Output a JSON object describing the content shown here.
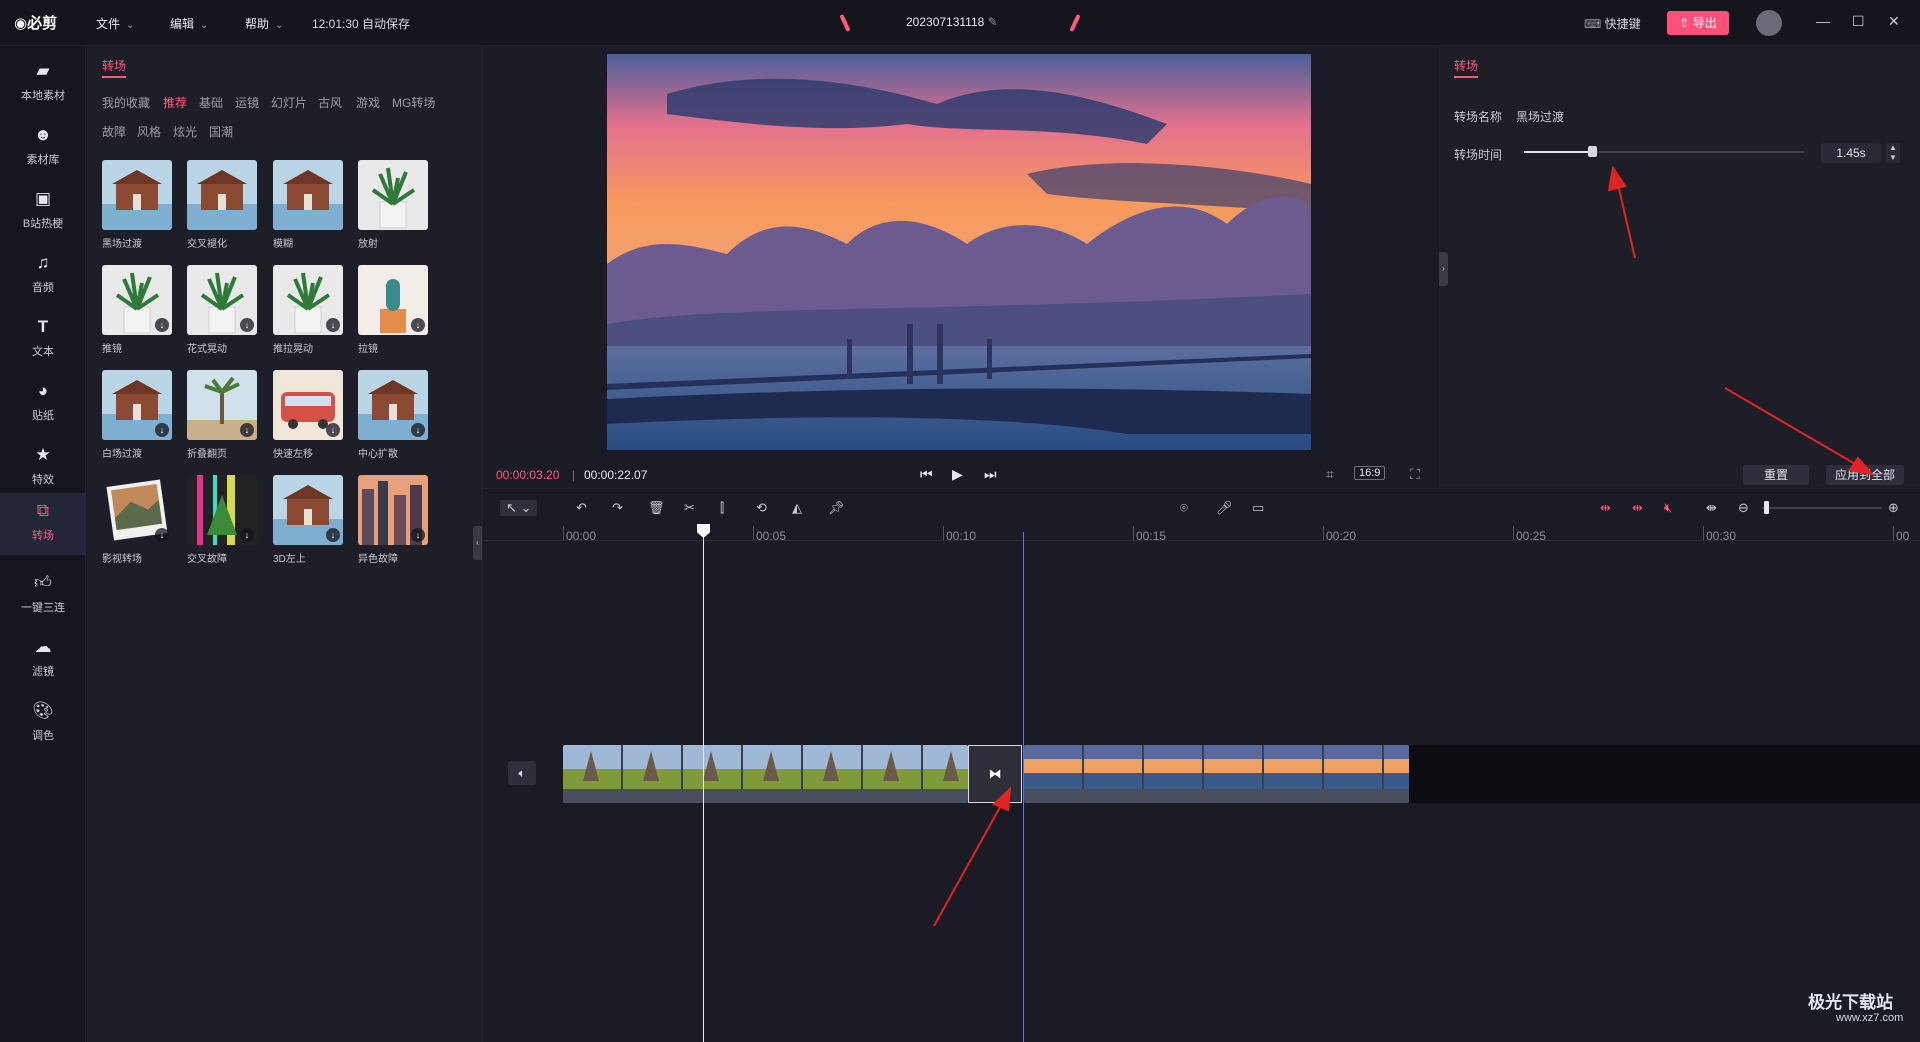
{
  "app": {
    "logo": "必剪",
    "menus": [
      "文件",
      "编辑",
      "帮助"
    ],
    "autosave": "12:01:30 自动保存",
    "project_title": "202307131118",
    "shortcut_label": "快捷键",
    "export_label": "导出"
  },
  "nav": [
    {
      "label": "本地素材",
      "icon": "folder-icon"
    },
    {
      "label": "素材库",
      "icon": "face-icon"
    },
    {
      "label": "B站热梗",
      "icon": "tv-icon"
    },
    {
      "label": "音频",
      "icon": "music-icon"
    },
    {
      "label": "文本",
      "icon": "text-icon"
    },
    {
      "label": "贴纸",
      "icon": "sticker-icon"
    },
    {
      "label": "特效",
      "icon": "star-icon"
    },
    {
      "label": "转场",
      "icon": "transition-icon",
      "active": true
    },
    {
      "label": "一键三连",
      "icon": "thumb-icon"
    },
    {
      "label": "滤镜",
      "icon": "filter-icon"
    },
    {
      "label": "调色",
      "icon": "palette-icon"
    }
  ],
  "library": {
    "tab": "转场",
    "categories_row1": [
      "我的收藏",
      "推荐",
      "基础",
      "运镜",
      "幻灯片",
      "古风",
      "游戏",
      "MG转场"
    ],
    "categories_row2": [
      "故障",
      "风格",
      "炫光",
      "国潮"
    ],
    "active_category": "推荐",
    "items": [
      {
        "label": "黑场过渡",
        "scene": "house",
        "download": false
      },
      {
        "label": "交叉褪化",
        "scene": "house",
        "download": false
      },
      {
        "label": "模糊",
        "scene": "house",
        "download": false
      },
      {
        "label": "放射",
        "scene": "plant",
        "download": false
      },
      {
        "label": "推镜",
        "scene": "plant",
        "download": true
      },
      {
        "label": "花式晃动",
        "scene": "plant",
        "download": true
      },
      {
        "label": "推拉晃动",
        "scene": "plant",
        "download": true
      },
      {
        "label": "拉镜",
        "scene": "cactus",
        "download": true
      },
      {
        "label": "白场过渡",
        "scene": "house",
        "download": true
      },
      {
        "label": "折叠翻页",
        "scene": "palm",
        "download": true
      },
      {
        "label": "快速左移",
        "scene": "bus",
        "download": true
      },
      {
        "label": "中心扩散",
        "scene": "house",
        "download": true
      },
      {
        "label": "影视转场",
        "scene": "photo",
        "download": true
      },
      {
        "label": "交叉故障",
        "scene": "glitch",
        "download": true
      },
      {
        "label": "3D左上",
        "scene": "house",
        "download": true
      },
      {
        "label": "异色故障",
        "scene": "city",
        "download": true
      }
    ]
  },
  "preview": {
    "current_time": "00:00:03.20",
    "total_time": "00:00:22.07",
    "ratio": "16:9"
  },
  "properties": {
    "tab": "转场",
    "name_label": "转场名称",
    "name_value": "黑场过渡",
    "duration_label": "转场时间",
    "duration_value": "1.45s",
    "reset_label": "重置",
    "apply_all_label": "应用到全部"
  },
  "timeline": {
    "ruler": [
      "00:00",
      "00:05",
      "00:10",
      "00:15",
      "00:20",
      "00:25",
      "00:30",
      "00"
    ]
  },
  "watermark": {
    "title": "极光下载站",
    "url": "www.xz7.com"
  },
  "colors": {
    "accent": "#ff5a7d",
    "background": "#1b1b25",
    "panel": "#1e1e29",
    "arrow": "#e02323"
  }
}
